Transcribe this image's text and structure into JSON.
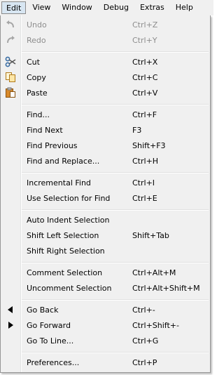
{
  "menubar": {
    "items": [
      {
        "label": "Edit"
      },
      {
        "label": "View"
      },
      {
        "label": "Window"
      },
      {
        "label": "Debug"
      },
      {
        "label": "Extras"
      },
      {
        "label": "Help"
      }
    ]
  },
  "menu": {
    "items": [
      {
        "label": "Undo",
        "shortcut": "Ctrl+Z",
        "icon": "undo-icon",
        "enabled": false
      },
      {
        "label": "Redo",
        "shortcut": "Ctrl+Y",
        "icon": "redo-icon",
        "enabled": false
      },
      {
        "label": "Cut",
        "shortcut": "Ctrl+X",
        "icon": "scissors-icon",
        "enabled": true
      },
      {
        "label": "Copy",
        "shortcut": "Ctrl+C",
        "icon": "copy-icon",
        "enabled": true
      },
      {
        "label": "Paste",
        "shortcut": "Ctrl+V",
        "icon": "paste-icon",
        "enabled": true
      },
      {
        "label": "Find...",
        "shortcut": "Ctrl+F",
        "enabled": true
      },
      {
        "label": "Find Next",
        "shortcut": "F3",
        "enabled": true
      },
      {
        "label": "Find Previous",
        "shortcut": "Shift+F3",
        "enabled": true
      },
      {
        "label": "Find and Replace...",
        "shortcut": "Ctrl+H",
        "enabled": true
      },
      {
        "label": "Incremental Find",
        "shortcut": "Ctrl+I",
        "enabled": true
      },
      {
        "label": "Use Selection for Find",
        "shortcut": "Ctrl+E",
        "enabled": true
      },
      {
        "label": "Auto Indent Selection",
        "shortcut": "",
        "enabled": true
      },
      {
        "label": "Shift Left Selection",
        "shortcut": "Shift+Tab",
        "enabled": true
      },
      {
        "label": "Shift Right Selection",
        "shortcut": "",
        "enabled": true
      },
      {
        "label": "Comment Selection",
        "shortcut": "Ctrl+Alt+M",
        "enabled": true
      },
      {
        "label": "Uncomment Selection",
        "shortcut": "Ctrl+Alt+Shift+M",
        "enabled": true
      },
      {
        "label": "Go Back",
        "shortcut": "Ctrl+-",
        "icon": "triangle-left-icon",
        "enabled": true
      },
      {
        "label": "Go Forward",
        "shortcut": "Ctrl+Shift+-",
        "icon": "triangle-right-icon",
        "enabled": true
      },
      {
        "label": "Go To Line...",
        "shortcut": "Ctrl+G",
        "enabled": true
      },
      {
        "label": "Preferences...",
        "shortcut": "Ctrl+P",
        "enabled": true
      }
    ]
  }
}
